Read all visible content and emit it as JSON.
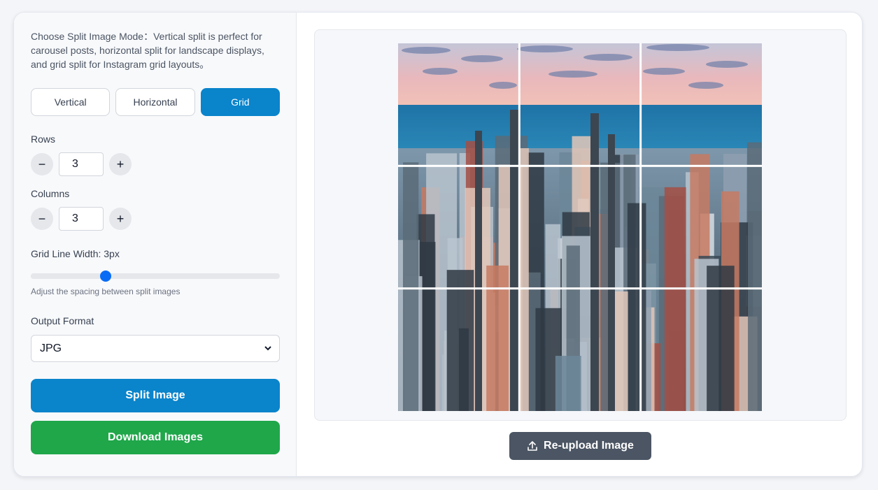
{
  "description": "Choose Split Image Mode：Vertical split is perfect for carousel posts, horizontal split for landscape displays, and grid split for Instagram grid layouts。",
  "modes": [
    {
      "label": "Vertical",
      "active": false
    },
    {
      "label": "Horizontal",
      "active": false
    },
    {
      "label": "Grid",
      "active": true
    }
  ],
  "rows": {
    "label": "Rows",
    "value": "3",
    "decrement": "−",
    "increment": "+"
  },
  "columns": {
    "label": "Columns",
    "value": "3",
    "decrement": "−",
    "increment": "+"
  },
  "grid_line": {
    "label": "Grid Line Width: 3px",
    "value": 3,
    "min": 0,
    "max": 10,
    "hint": "Adjust the spacing between split images"
  },
  "output_format": {
    "label": "Output Format",
    "selected": "JPG"
  },
  "actions": {
    "split": "Split Image",
    "download": "Download Images",
    "reupload": "Re-upload Image"
  },
  "preview": {
    "rows": 3,
    "columns": 3,
    "image": "aerial-city-skyline"
  },
  "colors": {
    "primary": "#0a84cb",
    "success": "#1fa74a",
    "slider_thumb": "#0a6cf5",
    "reupload_bg": "#4b5563"
  },
  "icons": {
    "upload": "upload-icon",
    "dropdown": "chevron-down-icon"
  }
}
